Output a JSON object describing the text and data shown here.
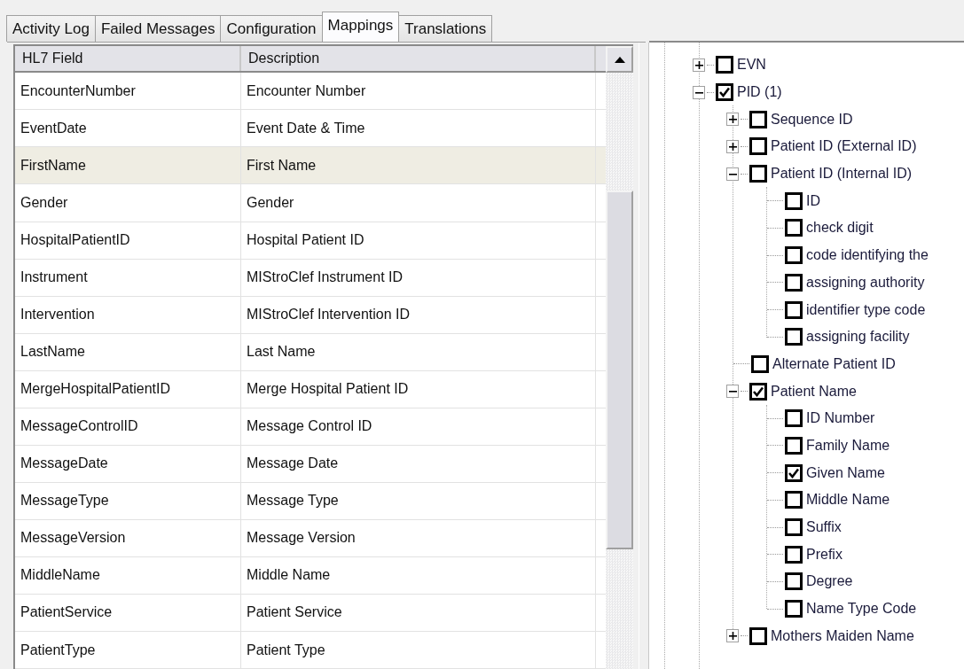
{
  "tabs": [
    {
      "label": "Activity Log",
      "selected": false
    },
    {
      "label": "Failed Messages",
      "selected": false
    },
    {
      "label": "Configuration",
      "selected": false
    },
    {
      "label": "Mappings",
      "selected": true
    },
    {
      "label": "Translations",
      "selected": false
    }
  ],
  "table": {
    "columns": [
      "HL7 Field",
      "Description"
    ],
    "rows": [
      {
        "cells": [
          "EncounterNumber",
          "Encounter Number"
        ],
        "selected": false
      },
      {
        "cells": [
          "EventDate",
          "Event Date & Time"
        ],
        "selected": false
      },
      {
        "cells": [
          "FirstName",
          "First Name"
        ],
        "selected": true
      },
      {
        "cells": [
          "Gender",
          "Gender"
        ],
        "selected": false
      },
      {
        "cells": [
          "HospitalPatientID",
          "Hospital Patient ID"
        ],
        "selected": false
      },
      {
        "cells": [
          "Instrument",
          "MIStroClef Instrument ID"
        ],
        "selected": false
      },
      {
        "cells": [
          "Intervention",
          "MIStroClef Intervention ID"
        ],
        "selected": false
      },
      {
        "cells": [
          "LastName",
          "Last Name"
        ],
        "selected": false
      },
      {
        "cells": [
          "MergeHospitalPatientID",
          "Merge Hospital Patient ID"
        ],
        "selected": false
      },
      {
        "cells": [
          "MessageControlID",
          "Message Control ID"
        ],
        "selected": false
      },
      {
        "cells": [
          "MessageDate",
          "Message Date"
        ],
        "selected": false
      },
      {
        "cells": [
          "MessageType",
          "Message Type"
        ],
        "selected": false
      },
      {
        "cells": [
          "MessageVersion",
          "Message Version"
        ],
        "selected": false
      },
      {
        "cells": [
          "MiddleName",
          "Middle Name"
        ],
        "selected": false
      },
      {
        "cells": [
          "PatientService",
          "Patient Service"
        ],
        "selected": false
      },
      {
        "cells": [
          "PatientType",
          "Patient Type"
        ],
        "selected": false
      }
    ]
  },
  "tree": [
    {
      "label": "EVN",
      "kind": "group",
      "expanded": false,
      "checked": false
    },
    {
      "label": "PID  (1)",
      "kind": "group",
      "expanded": true,
      "checked": true,
      "children": [
        {
          "label": "Sequence ID",
          "kind": "group",
          "expanded": false,
          "checked": false
        },
        {
          "label": "Patient ID (External ID)",
          "kind": "group",
          "expanded": false,
          "checked": false
        },
        {
          "label": "Patient ID (Internal ID)",
          "kind": "group",
          "expanded": true,
          "checked": false,
          "children": [
            {
              "label": "ID",
              "kind": "leaf",
              "checked": false
            },
            {
              "label": "check digit",
              "kind": "leaf",
              "checked": false
            },
            {
              "label": "code identifying the",
              "kind": "leaf",
              "checked": false
            },
            {
              "label": "assigning authority",
              "kind": "leaf",
              "checked": false
            },
            {
              "label": "identifier type code",
              "kind": "leaf",
              "checked": false
            },
            {
              "label": "assigning facility",
              "kind": "leaf",
              "checked": false
            }
          ]
        },
        {
          "label": "Alternate Patient ID",
          "kind": "leaf",
          "checked": false
        },
        {
          "label": "Patient Name",
          "kind": "group",
          "expanded": true,
          "checked": true,
          "children": [
            {
              "label": "ID Number",
              "kind": "leaf",
              "checked": false
            },
            {
              "label": "Family Name",
              "kind": "leaf",
              "checked": false
            },
            {
              "label": "Given Name",
              "kind": "leaf",
              "checked": true
            },
            {
              "label": "Middle Name",
              "kind": "leaf",
              "checked": false
            },
            {
              "label": "Suffix",
              "kind": "leaf",
              "checked": false
            },
            {
              "label": "Prefix",
              "kind": "leaf",
              "checked": false
            },
            {
              "label": "Degree",
              "kind": "leaf",
              "checked": false
            },
            {
              "label": "Name Type Code",
              "kind": "leaf",
              "checked": false
            }
          ]
        },
        {
          "label": "Mothers Maiden Name",
          "kind": "group",
          "expanded": false,
          "checked": false
        }
      ]
    }
  ]
}
